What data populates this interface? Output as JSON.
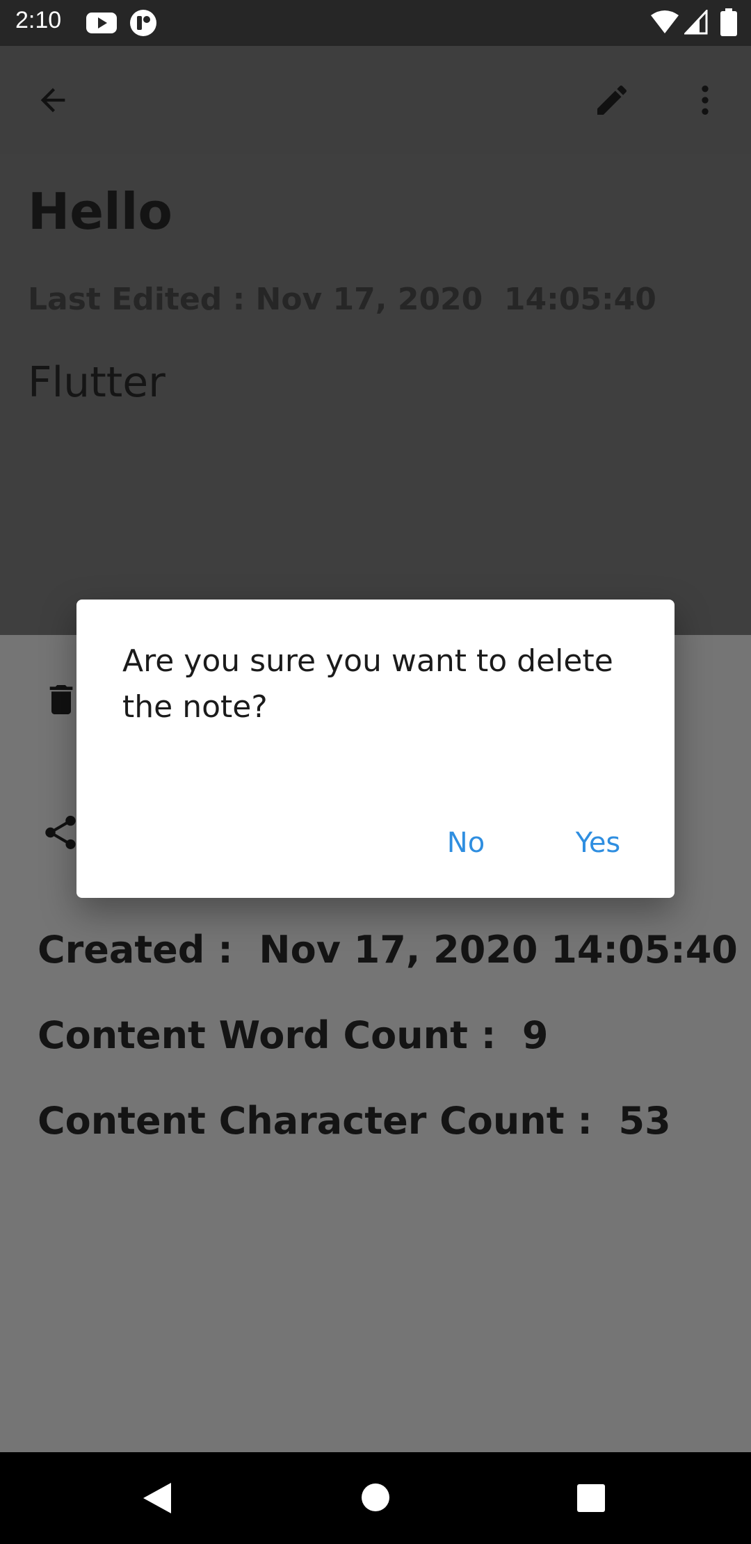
{
  "status_bar": {
    "time": "2:10",
    "icons": [
      "youtube-icon",
      "app-notification-icon",
      "wifi-icon",
      "signal-icon",
      "battery-icon"
    ]
  },
  "app_bar": {
    "icons": [
      "back-arrow-icon",
      "edit-pencil-icon",
      "more-vert-icon"
    ]
  },
  "note": {
    "title": "Hello",
    "last_edited": "Last Edited : Nov 17, 2020  14:05:40",
    "content": "Flutter"
  },
  "bottom_sheet": {
    "icons": [
      "trash-icon",
      "share-icon"
    ],
    "created": "Created :  Nov 17, 2020 14:05:40",
    "word_count": "Content Word Count :  9",
    "char_count": "Content Character Count :  53"
  },
  "dialog": {
    "message": "Are you sure you want to delete the note?",
    "no_label": "No",
    "yes_label": "Yes"
  },
  "nav_bar": {
    "icons": [
      "back-triangle-icon",
      "home-circle-icon",
      "recents-square-icon"
    ]
  },
  "colors": {
    "accent": "#2f8ee0",
    "scrim_note": "#3f3f3f",
    "scrim_sheet": "#757575",
    "status_bar": "#262626"
  }
}
